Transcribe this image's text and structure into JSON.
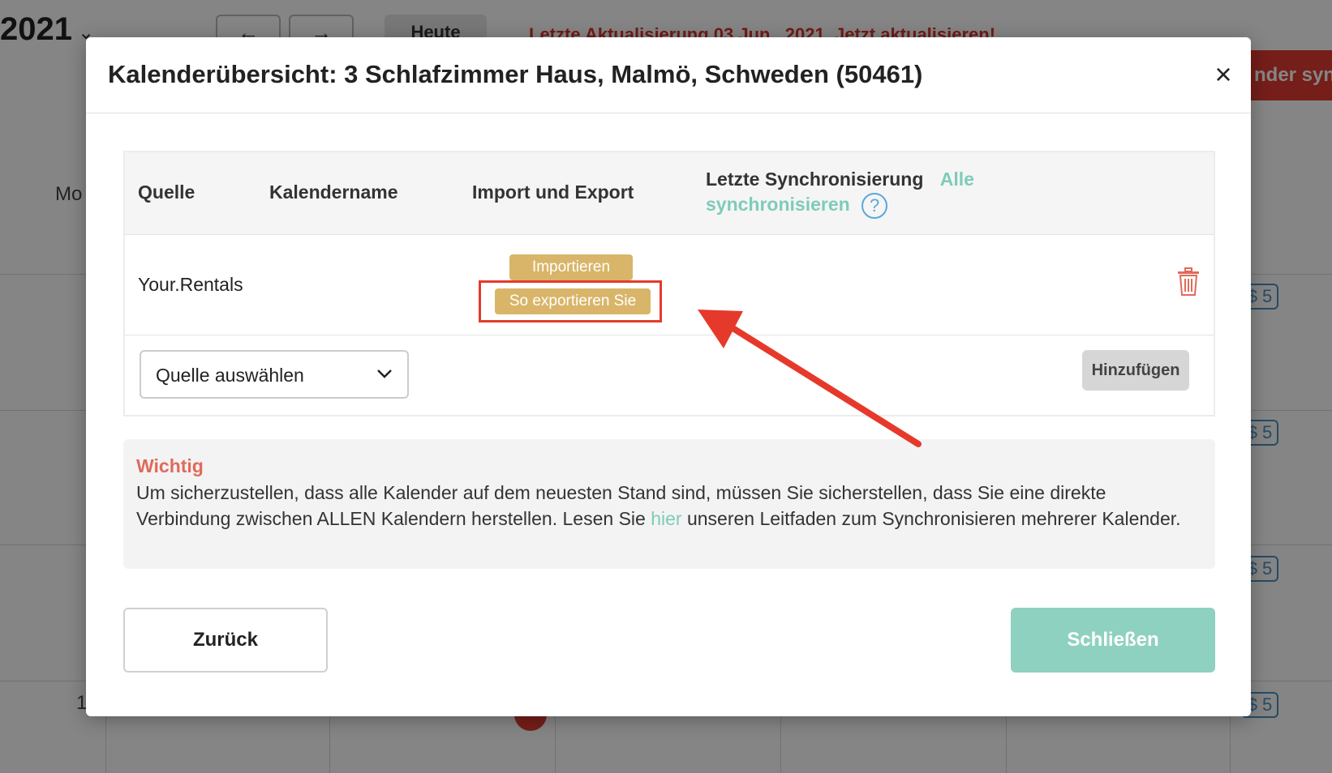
{
  "background": {
    "year": "2021",
    "nav_prev": "←",
    "nav_next": "→",
    "today_label": "Heute",
    "update_text": "Letzte Aktualisierung 03 Jun . 2021. Jetzt aktualisieren!",
    "sync_button": "nder sync",
    "weekday": "Mo",
    "day_number": "1",
    "badge_text": "$ 5"
  },
  "modal": {
    "title": "Kalenderübersicht: 3 Schlafzimmer Haus, Malmö, Schweden (50461)",
    "close_symbol": "×",
    "table": {
      "headers": {
        "source": "Quelle",
        "calendar_name": "Kalendername",
        "import_export": "Import und Export",
        "last_sync": "Letzte Synchronisierung",
        "sync_all_part1": "Alle",
        "sync_all_part2": "synchronisieren",
        "help": "?"
      },
      "rows": [
        {
          "source": "Your.Rentals",
          "calendar_name": "",
          "import_label": "Importieren",
          "export_label": "So exportieren Sie",
          "last_sync": ""
        }
      ],
      "add_row": {
        "select_value": "Quelle auswählen",
        "add_label": "Hinzufügen"
      }
    },
    "note": {
      "title": "Wichtig",
      "text_before": "Um sicherzustellen, dass alle Kalender auf dem neuesten Stand sind, müssen Sie sicherstellen, dass Sie eine direkte Verbindung zwischen ALLEN Kalendern herstellen. Lesen Sie ",
      "link": "hier",
      "text_after": " unseren Leitfaden zum Synchronisieren mehrerer Kalender."
    },
    "footer": {
      "back_label": "Zurück",
      "close_label": "Schließen"
    }
  },
  "colors": {
    "accent_teal": "#8fd1c0",
    "gold_button": "#d9b569",
    "annotation_red": "#e53a2b",
    "warning_title": "#e06a5a"
  }
}
